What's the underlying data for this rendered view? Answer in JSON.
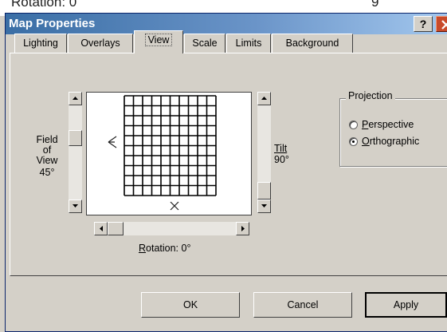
{
  "background_caption": {
    "left": "Rotation: 0",
    "right": "9"
  },
  "window": {
    "title": "Map Properties",
    "help_label": "?"
  },
  "tabs": [
    {
      "label": "Lighting",
      "active": false
    },
    {
      "label": "Overlays",
      "active": false
    },
    {
      "label": "View",
      "active": true
    },
    {
      "label": "Scale",
      "active": false
    },
    {
      "label": "Limits",
      "active": false
    },
    {
      "label": "Background",
      "active": false
    }
  ],
  "view": {
    "field_of_view": {
      "label_lines": [
        "Field",
        "of",
        "View"
      ],
      "value": "45°",
      "slider_value_deg": 45
    },
    "tilt": {
      "label": "Tilt",
      "value": "90°",
      "slider_value_deg": 90
    },
    "rotation": {
      "label": "Rotation: 0°",
      "slider_value_deg": 0
    }
  },
  "projection": {
    "title": "Projection",
    "options": [
      {
        "label": "Perspective",
        "selected": false
      },
      {
        "label": "Orthographic",
        "selected": true
      }
    ]
  },
  "buttons": {
    "ok": "OK",
    "cancel": "Cancel",
    "apply": "Apply"
  },
  "colors": {
    "dialog_face": "#d4d0c8",
    "title_bar_start": "#3a6ea5",
    "title_bar_end": "#a6caf0",
    "close_button": "#c84a2a"
  }
}
